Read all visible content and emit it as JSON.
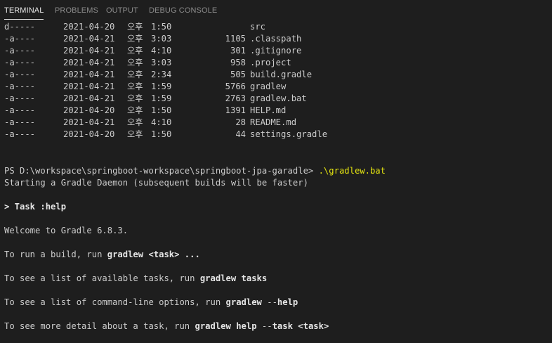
{
  "tabs": [
    {
      "label": "TERMINAL",
      "active": true
    },
    {
      "label": "PROBLEMS",
      "active": false
    },
    {
      "label": "OUTPUT",
      "active": false
    },
    {
      "label": "DEBUG CONSOLE",
      "active": false
    }
  ],
  "listing": [
    {
      "mode": "d-----",
      "date": "2021-04-20",
      "ampm": "오후",
      "time": "1:50",
      "size": "",
      "name": "src"
    },
    {
      "mode": "-a----",
      "date": "2021-04-21",
      "ampm": "오후",
      "time": "3:03",
      "size": "1105",
      "name": ".classpath"
    },
    {
      "mode": "-a----",
      "date": "2021-04-21",
      "ampm": "오후",
      "time": "4:10",
      "size": "301",
      "name": ".gitignore"
    },
    {
      "mode": "-a----",
      "date": "2021-04-21",
      "ampm": "오후",
      "time": "3:03",
      "size": "958",
      "name": ".project"
    },
    {
      "mode": "-a----",
      "date": "2021-04-21",
      "ampm": "오후",
      "time": "2:34",
      "size": "505",
      "name": "build.gradle"
    },
    {
      "mode": "-a----",
      "date": "2021-04-21",
      "ampm": "오후",
      "time": "1:59",
      "size": "5766",
      "name": "gradlew"
    },
    {
      "mode": "-a----",
      "date": "2021-04-21",
      "ampm": "오후",
      "time": "1:59",
      "size": "2763",
      "name": "gradlew.bat"
    },
    {
      "mode": "-a----",
      "date": "2021-04-20",
      "ampm": "오후",
      "time": "1:50",
      "size": "1391",
      "name": "HELP.md"
    },
    {
      "mode": "-a----",
      "date": "2021-04-21",
      "ampm": "오후",
      "time": "4:10",
      "size": "28",
      "name": "README.md"
    },
    {
      "mode": "-a----",
      "date": "2021-04-20",
      "ampm": "오후",
      "time": "1:50",
      "size": "44",
      "name": "settings.gradle"
    }
  ],
  "prompt": {
    "path": "PS D:\\workspace\\springboot-workspace\\springboot-jpa-garadle> ",
    "command": ".\\gradlew.bat"
  },
  "output": {
    "daemon": "Starting a Gradle Daemon (subsequent builds will be faster)",
    "task_header": "> Task :help",
    "welcome": "Welcome to Gradle 6.8.3.",
    "run_build_pre": "To run a build, run ",
    "run_build_cmd": "gradlew <task> ...",
    "list_tasks_pre": "To see a list of available tasks, run ",
    "list_tasks_cmd": "gradlew tasks",
    "options_pre": "To see a list of command-line options, run ",
    "options_cmd1": "gradlew",
    "options_mid": " --",
    "options_cmd2": "help",
    "detail_pre": "To see more detail about a task, run ",
    "detail_cmd1": "gradlew help",
    "detail_mid": " --",
    "detail_cmd2": "task <task>"
  }
}
